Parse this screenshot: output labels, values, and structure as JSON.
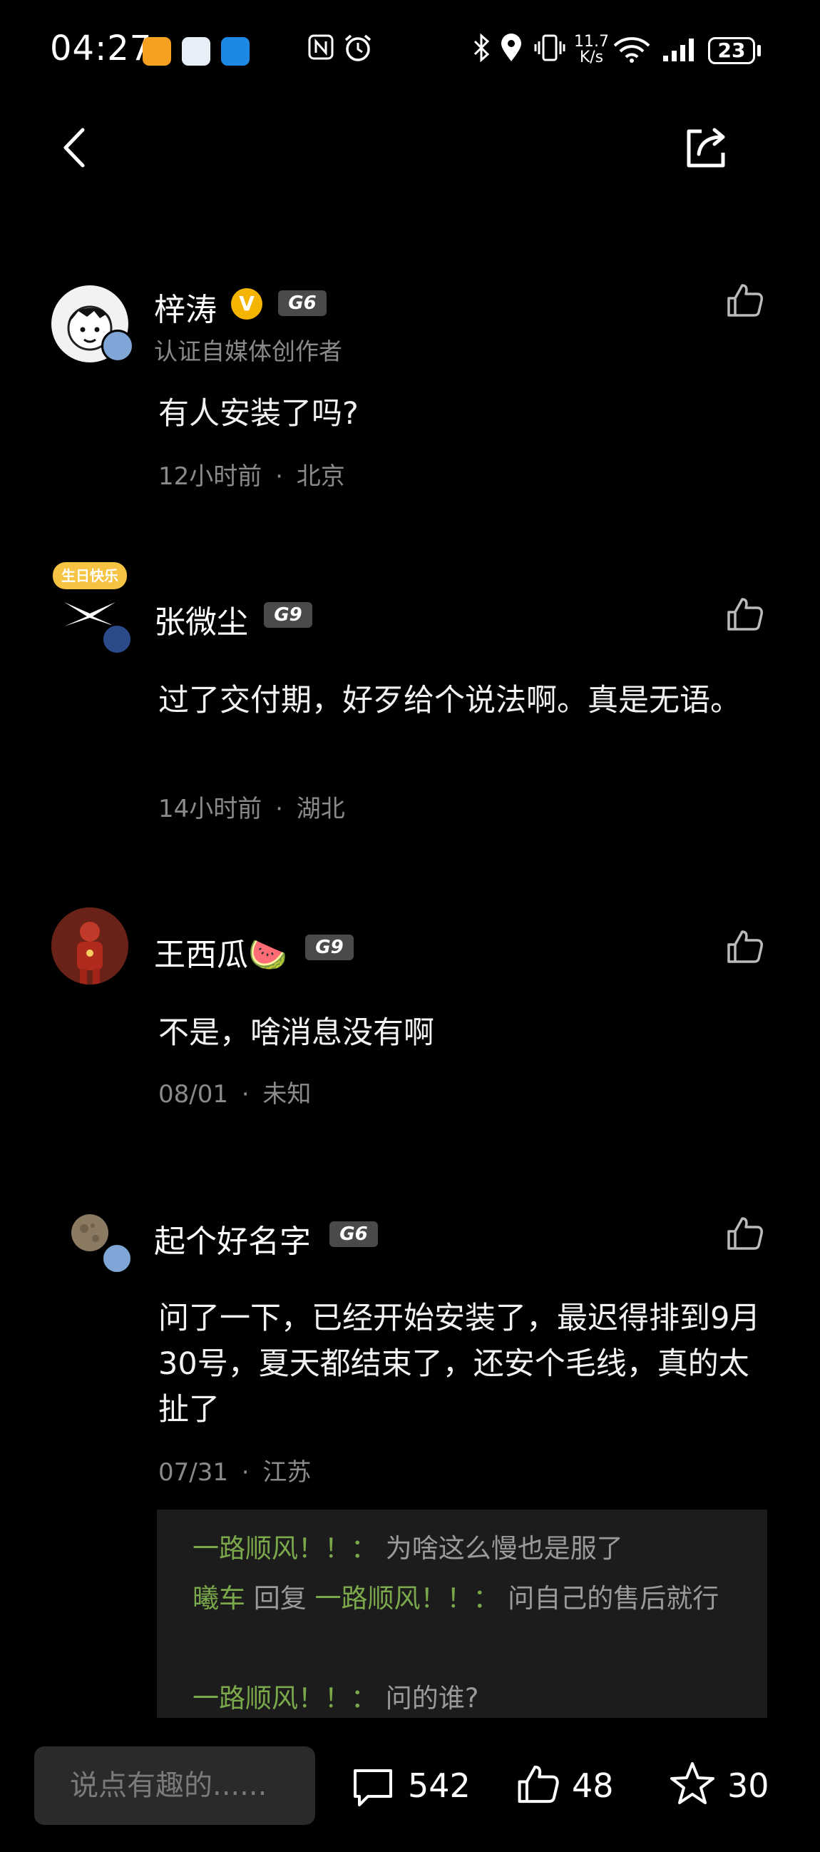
{
  "status_bar": {
    "time": "04:27",
    "net_speed_value": "11.7",
    "net_speed_unit": "K/s",
    "battery": "23"
  },
  "comments": [
    {
      "name": "梓涛",
      "level": "G6",
      "subtitle": "认证自媒体创作者",
      "content": "有人安装了吗?",
      "time": "12小时前",
      "location": "北京"
    },
    {
      "name": "张微尘",
      "level": "G9",
      "badge_text": "生日快乐",
      "content": "过了交付期，好歹给个说法啊。真是无语。",
      "time": "14小时前",
      "location": "湖北"
    },
    {
      "name": "王西瓜🍉",
      "level": "G9",
      "content": "不是，啥消息没有啊",
      "time": "08/01",
      "location": "未知"
    },
    {
      "name": "起个好名字",
      "level": "G6",
      "content": "问了一下，已经开始安装了，最迟得排到9月30号，夏天都结束了，还安个毛线，真的太扯了",
      "time": "07/31",
      "location": "江苏"
    }
  ],
  "replies": [
    {
      "author": "一路顺风！！：",
      "text": "为啥这么慢也是服了"
    },
    {
      "author": "曦车",
      "verb": "回复",
      "target": "一路顺风！！：",
      "text": "问自己的售后就行"
    },
    {
      "author": "一路顺风！！：",
      "text": "问的谁?"
    }
  ],
  "meta_separator": "·",
  "bottom_bar": {
    "input_placeholder": "说点有趣的......",
    "comment_count": "542",
    "like_count": "48",
    "favorite_count": "30"
  },
  "colors": {
    "background": "#000000",
    "reply_author": "#7aa84a",
    "meta_text": "#8a8a8a",
    "verified_badge": "#f5b400"
  }
}
